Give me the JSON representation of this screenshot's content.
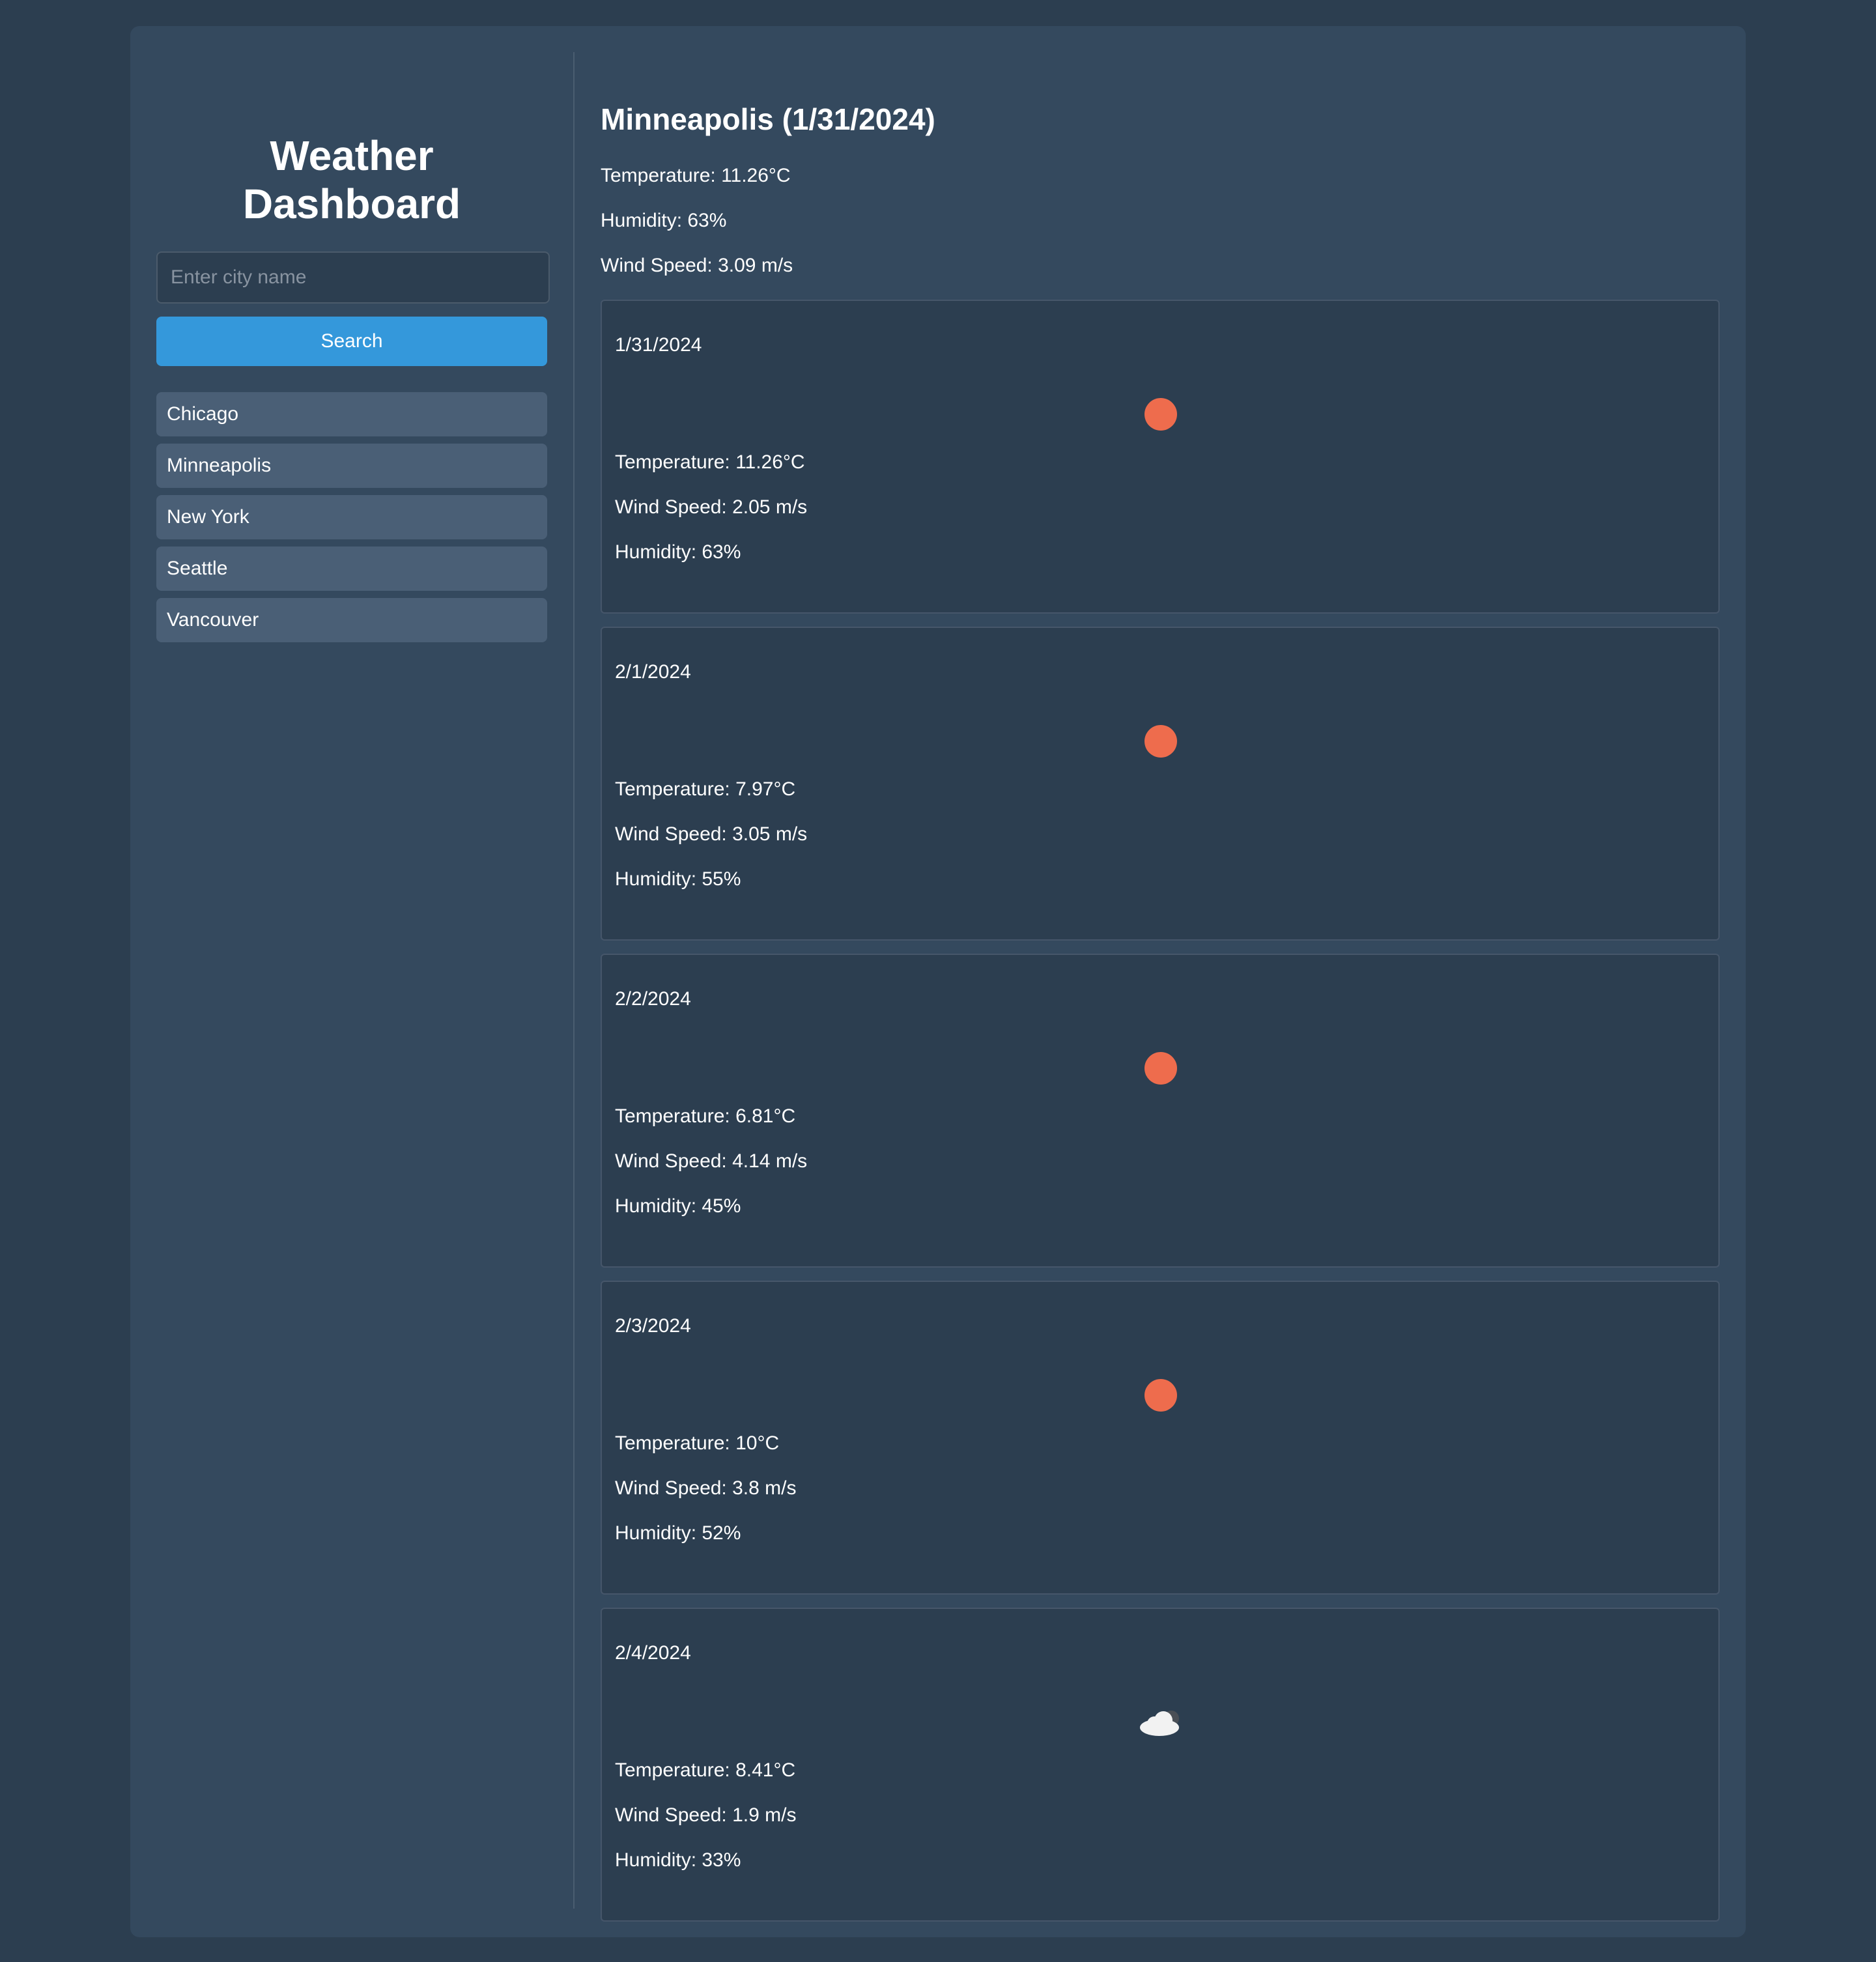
{
  "sidebar": {
    "title_line1": "Weather",
    "title_line2": "Dashboard",
    "search_placeholder": "Enter city name",
    "search_button": "Search",
    "history": [
      "Chicago",
      "Minneapolis",
      "New York",
      "Seattle",
      "Vancouver"
    ]
  },
  "current": {
    "title": "Minneapolis (1/31/2024)",
    "temperature": "Temperature: 11.26°C",
    "humidity": "Humidity: 63%",
    "wind": "Wind Speed: 3.09 m/s"
  },
  "forecast": [
    {
      "date": "1/31/2024",
      "icon": "sun-icon",
      "temperature": "Temperature: 11.26°C",
      "wind": "Wind Speed: 2.05 m/s",
      "humidity": "Humidity: 63%"
    },
    {
      "date": "2/1/2024",
      "icon": "sun-icon",
      "temperature": "Temperature: 7.97°C",
      "wind": "Wind Speed: 3.05 m/s",
      "humidity": "Humidity: 55%"
    },
    {
      "date": "2/2/2024",
      "icon": "sun-icon",
      "temperature": "Temperature: 6.81°C",
      "wind": "Wind Speed: 4.14 m/s",
      "humidity": "Humidity: 45%"
    },
    {
      "date": "2/3/2024",
      "icon": "sun-icon",
      "temperature": "Temperature: 10°C",
      "wind": "Wind Speed: 3.8 m/s",
      "humidity": "Humidity: 52%"
    },
    {
      "date": "2/4/2024",
      "icon": "cloud-icon",
      "temperature": "Temperature: 8.41°C",
      "wind": "Wind Speed: 1.9 m/s",
      "humidity": "Humidity: 33%"
    }
  ],
  "colors": {
    "page_background": "#2c3e50",
    "panel_background": "#34495e",
    "accent": "#3498db",
    "history_item": "#4a5f76",
    "sun": "#ee6c4d"
  }
}
